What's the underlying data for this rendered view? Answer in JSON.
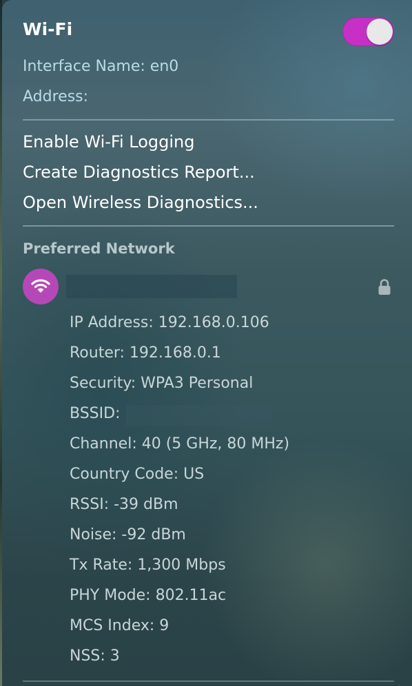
{
  "wifi": {
    "title": "Wi-Fi",
    "toggle_on": true,
    "toggle_color": "#c630c5"
  },
  "interface": {
    "name_line": "Interface Name: en0",
    "address_line": "Address:"
  },
  "menu": {
    "items": [
      {
        "label": "Enable Wi-Fi Logging"
      },
      {
        "label": "Create Diagnostics Report..."
      },
      {
        "label": "Open Wireless Diagnostics..."
      }
    ]
  },
  "preferred": {
    "header": "Preferred Network",
    "icon": "wifi-icon",
    "icon_color": "#b548b6",
    "lock_icon": "lock-icon"
  },
  "details": [
    {
      "text": "IP Address: 192.168.0.106"
    },
    {
      "text": "Router: 192.168.0.1"
    },
    {
      "text": "Security: WPA3 Personal"
    },
    {
      "text": "BSSID:"
    },
    {
      "text": "Channel: 40 (5 GHz, 80 MHz)"
    },
    {
      "text": "Country Code: US"
    },
    {
      "text": "RSSI: -39 dBm"
    },
    {
      "text": "Noise: -92 dBm"
    },
    {
      "text": "Tx Rate: 1,300 Mbps"
    },
    {
      "text": "PHY Mode: 802.11ac"
    },
    {
      "text": "MCS Index: 9"
    },
    {
      "text": "NSS: 3"
    }
  ]
}
